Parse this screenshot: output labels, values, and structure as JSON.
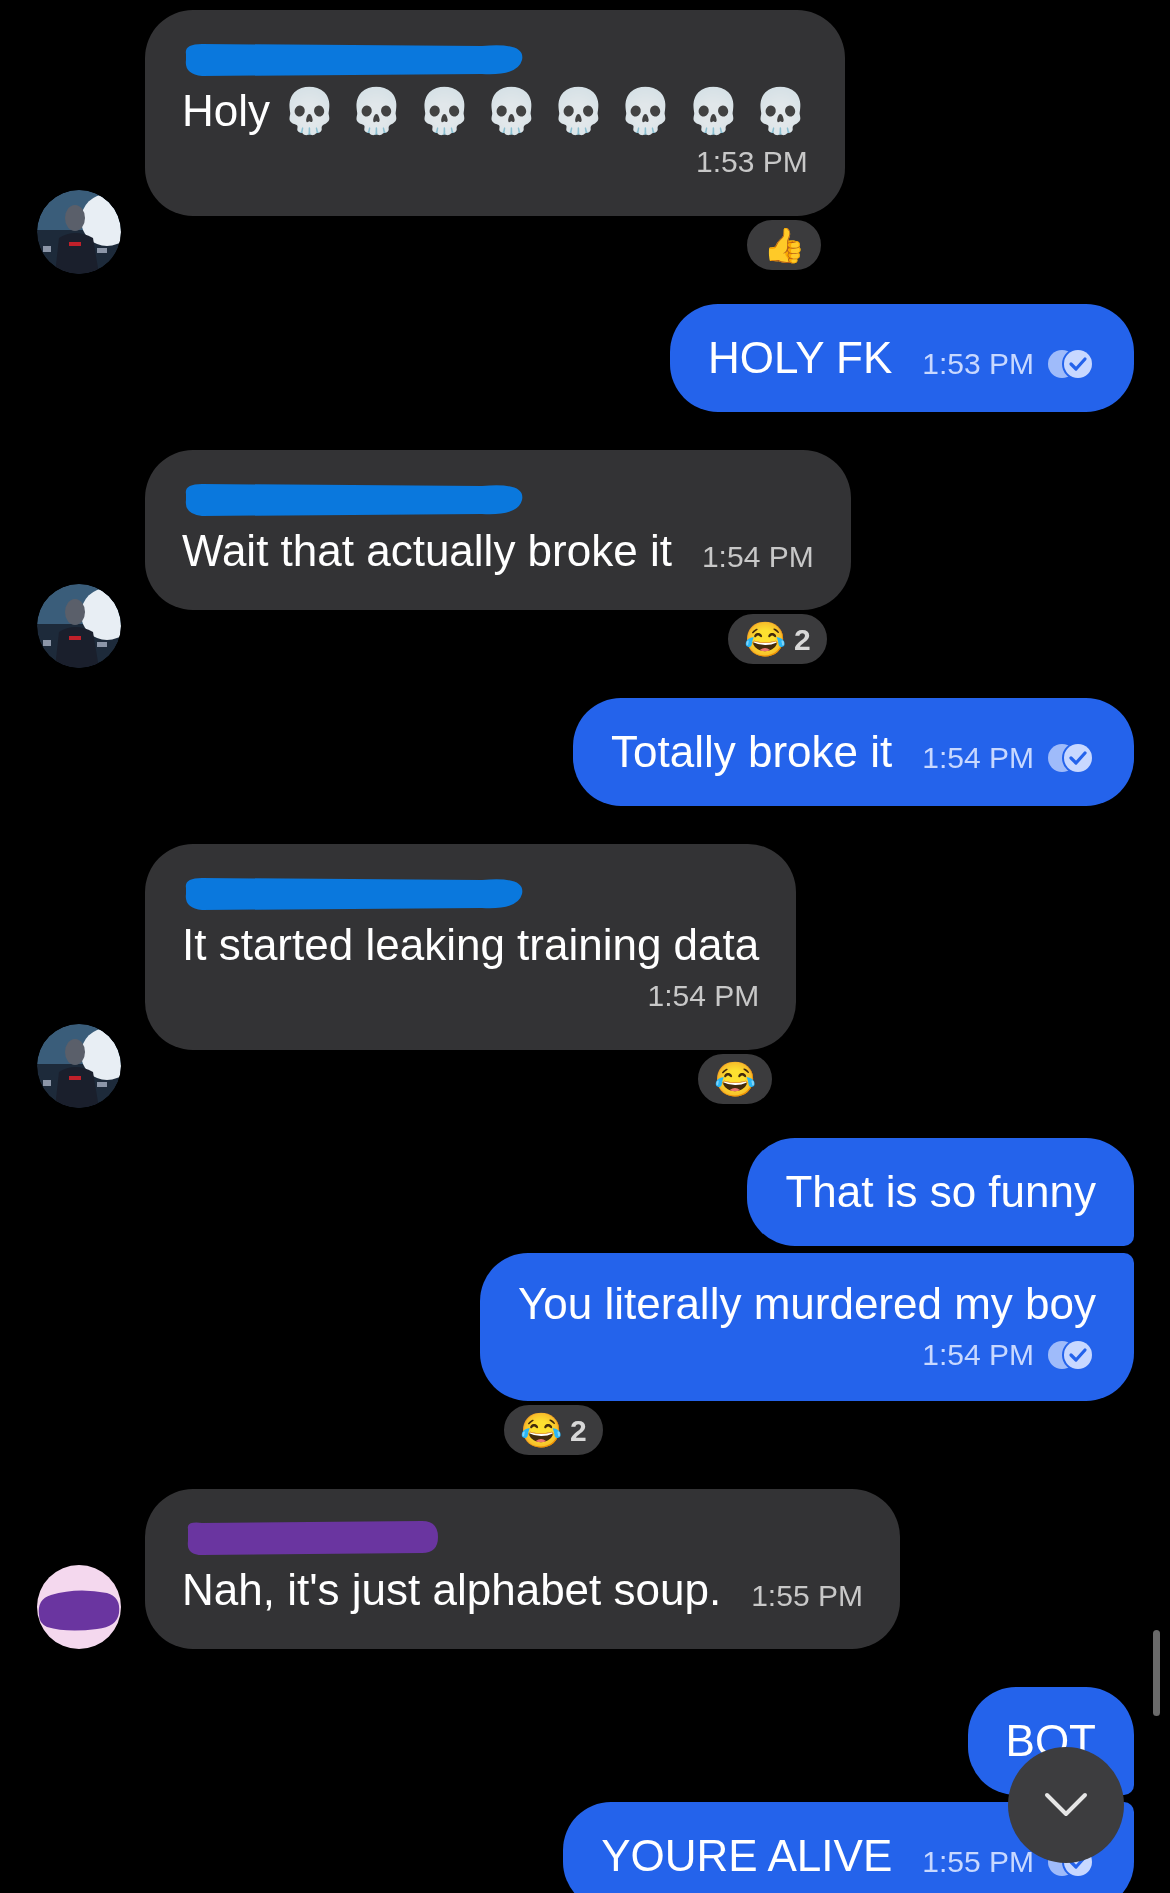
{
  "messages": [
    {
      "outgoing": false,
      "redacted_avatar": false,
      "color": "#0a78dd",
      "text": "Holy 💀 💀 💀 💀 💀 💀 💀 💀",
      "time": "1:53 PM",
      "time_below": true,
      "reaction": {
        "emoji": "👍"
      }
    },
    {
      "outgoing": true,
      "text": "HOLY FK",
      "time": "1:53 PM",
      "read": true,
      "time_below": false
    },
    {
      "outgoing": false,
      "redacted_avatar": false,
      "color": "#0a78dd",
      "text": "Wait that actually broke it",
      "time": "1:54 PM",
      "time_below": false,
      "reaction": {
        "emoji": "😂",
        "count": "2"
      }
    },
    {
      "outgoing": true,
      "text": "Totally broke it",
      "time": "1:54 PM",
      "read": true,
      "time_below": false
    },
    {
      "outgoing": false,
      "redacted_avatar": false,
      "color": "#0a78dd",
      "text": "It started leaking training data",
      "time": "1:54 PM",
      "time_below": true,
      "reaction": {
        "emoji": "😂"
      }
    },
    {
      "outgoing": true,
      "text": "That is so funny",
      "time_below": false
    },
    {
      "outgoing": true,
      "text": "You literally murdered my boy",
      "time": "1:54 PM",
      "read": true,
      "time_below": true,
      "reaction": {
        "emoji": "😂",
        "count": "2"
      }
    },
    {
      "outgoing": false,
      "redacted_avatar": true,
      "color": "#6a35a0",
      "text": "Nah, it's just alphabet soup.",
      "time": "1:55 PM",
      "time_below": false
    },
    {
      "outgoing": true,
      "text": "BOT",
      "time_below": false
    },
    {
      "outgoing": true,
      "text": "YOURE ALIVE",
      "time": "1:55 PM",
      "read": true,
      "time_below": false
    }
  ]
}
